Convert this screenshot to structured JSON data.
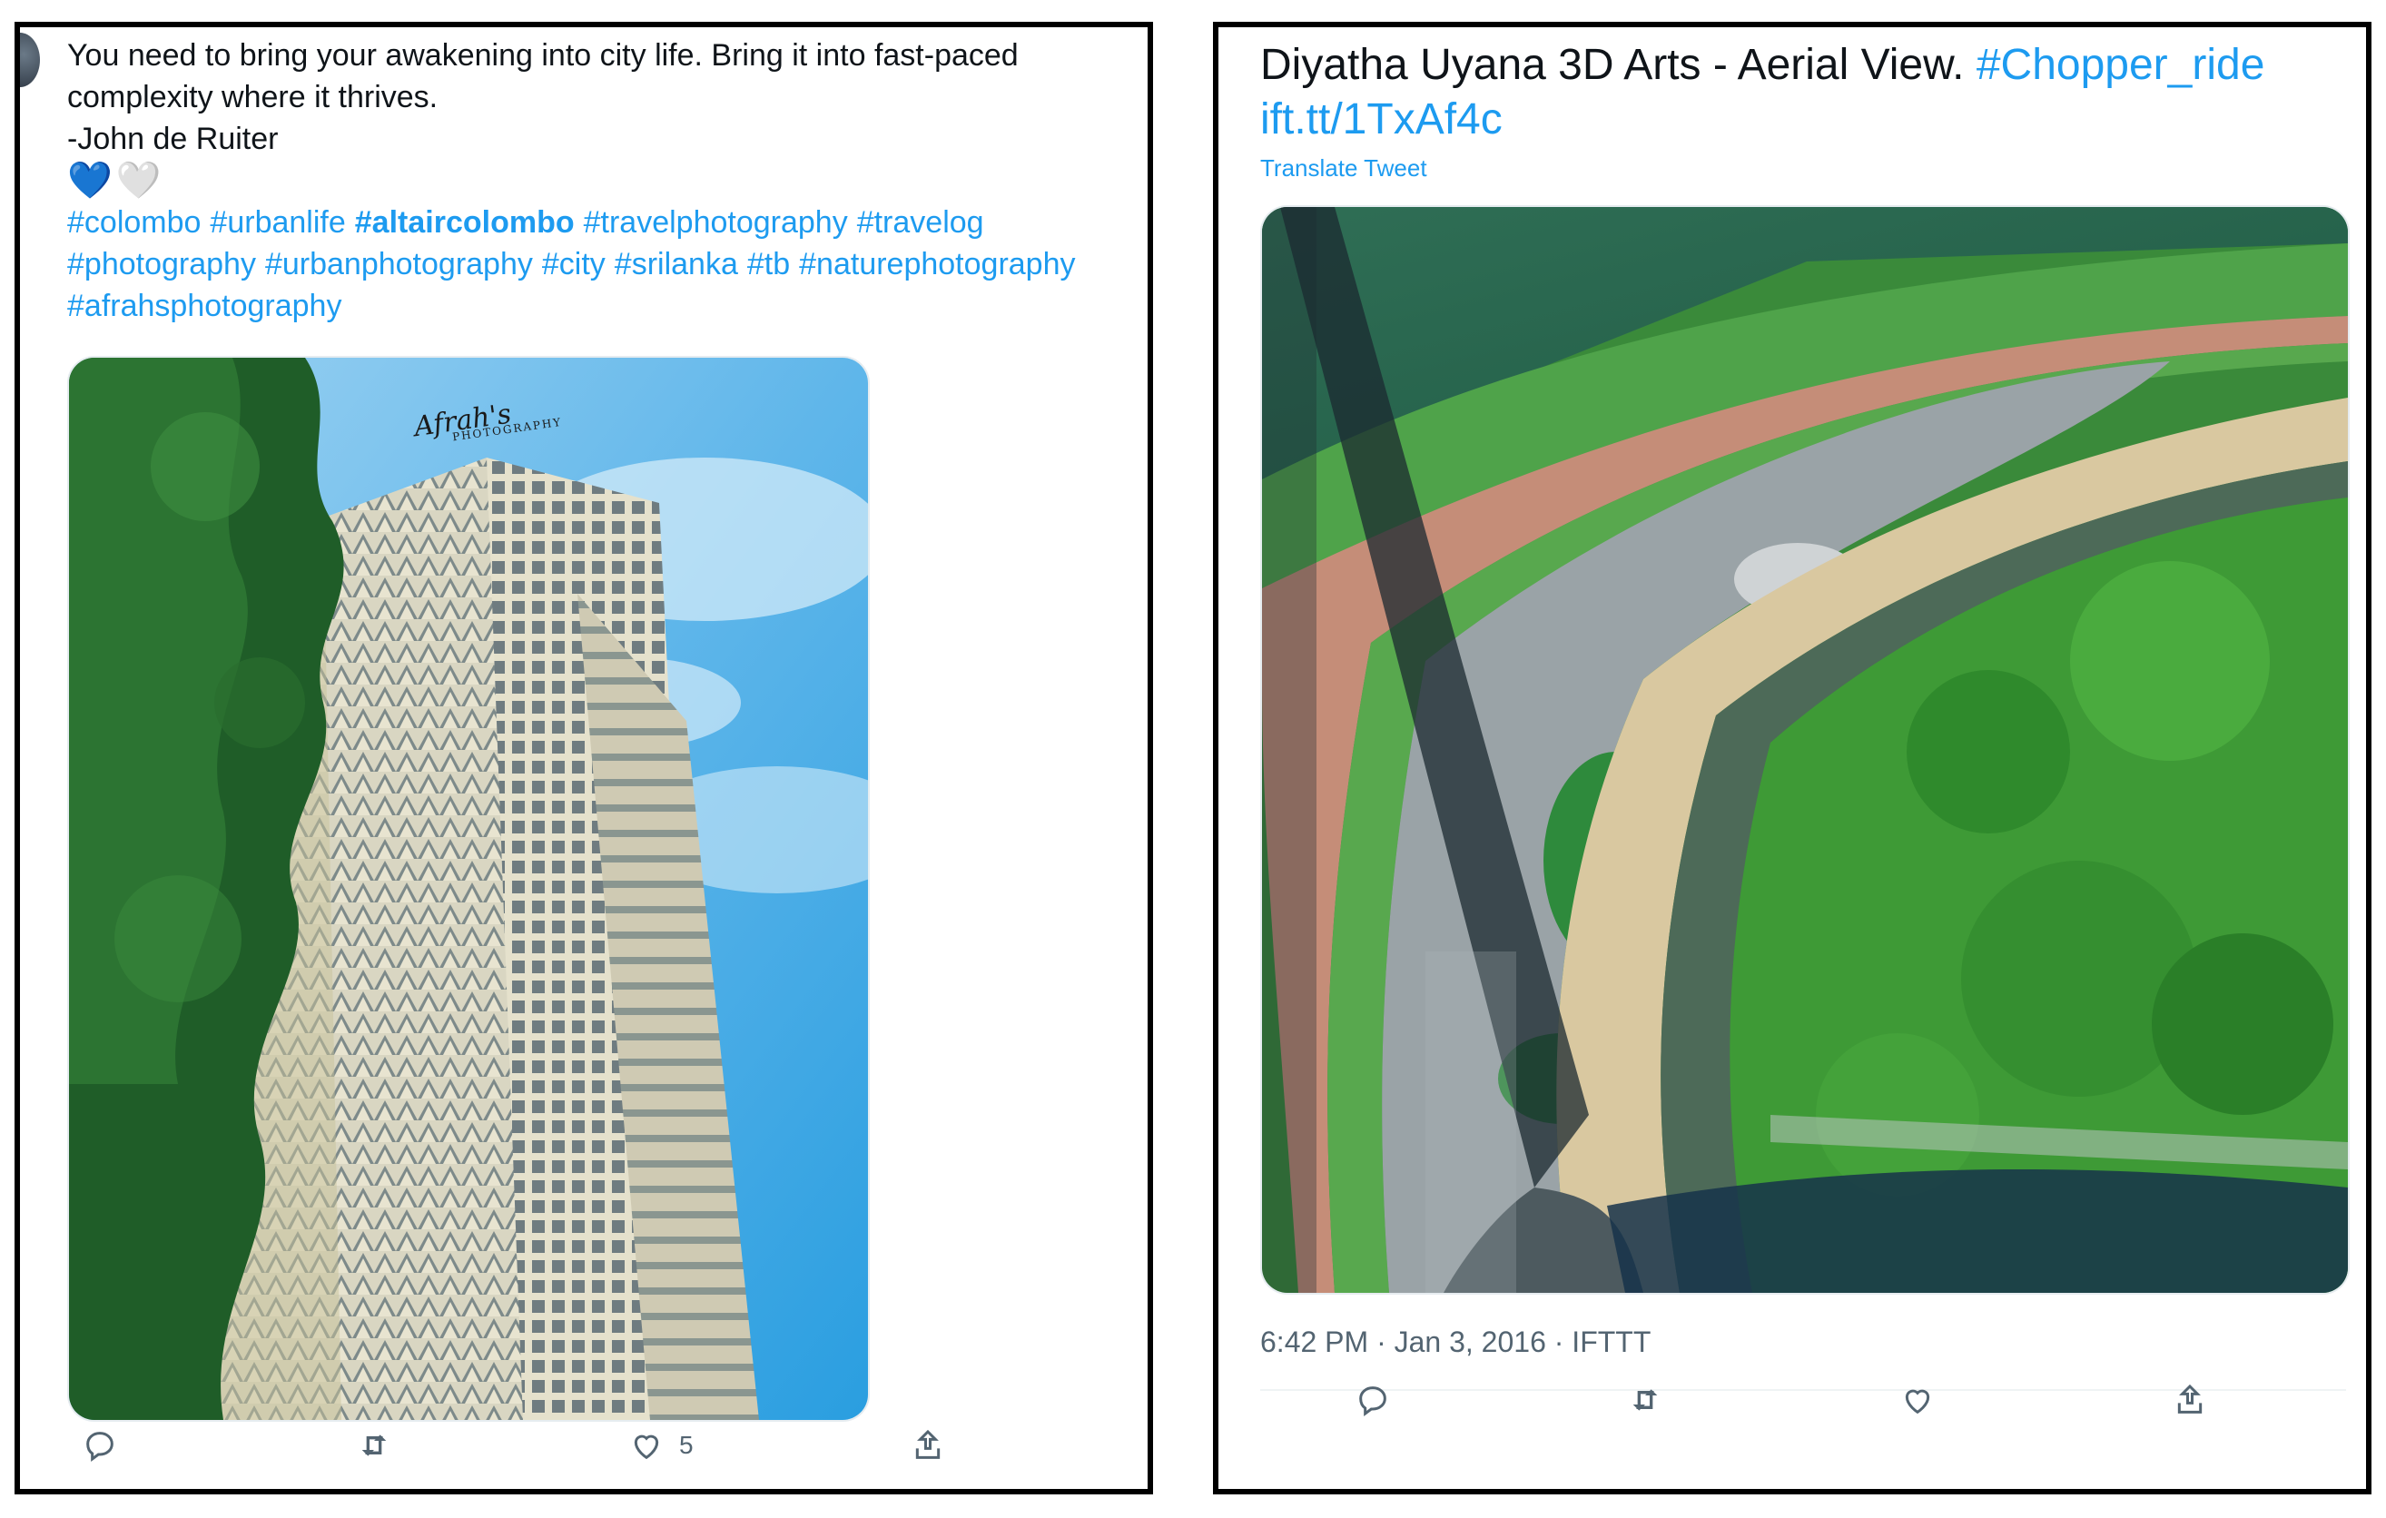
{
  "left_tweet": {
    "text_lines": [
      "You need to bring your awakening into city life. Bring it into fast-paced",
      "complexity where it thrives.",
      "-John de Ruiter"
    ],
    "hearts": [
      "💙",
      "🤍"
    ],
    "hashtag_lines": [
      [
        {
          "text": "#colombo",
          "bold": false
        },
        {
          "text": "#urbanlife",
          "bold": false
        },
        {
          "text": "#altaircolombo",
          "bold": true
        },
        {
          "text": "#travelphotography",
          "bold": false
        },
        {
          "text": "#travelog",
          "bold": false
        }
      ],
      [
        {
          "text": "#photography",
          "bold": false
        },
        {
          "text": "#urbanphotography",
          "bold": false
        },
        {
          "text": "#city",
          "bold": false
        },
        {
          "text": "#srilanka",
          "bold": false
        },
        {
          "text": "#tb",
          "bold": false
        },
        {
          "text": "#naturephotography",
          "bold": false
        }
      ],
      [
        {
          "text": "#afrahsphotography",
          "bold": false
        }
      ]
    ],
    "photo": {
      "watermark_text": "Afrah's",
      "watermark_sub": "PHOTOGRAPHY"
    },
    "actions": {
      "reply": "",
      "retweet": "",
      "like_count": "5",
      "share": ""
    }
  },
  "right_tweet": {
    "title_text": "Diyatha Uyana 3D Arts - Aerial View.",
    "hashtag": "#Chopper_ride",
    "link": "ift.tt/1TxAf4c",
    "translate": "Translate Tweet",
    "timestamp": "6:42 PM · Jan 3, 2016 · IFTTT"
  },
  "colors": {
    "link": "#1d9bf0",
    "muted": "#536471",
    "border": "#000000"
  },
  "icons": [
    "reply-icon",
    "retweet-icon",
    "like-icon",
    "share-icon"
  ]
}
